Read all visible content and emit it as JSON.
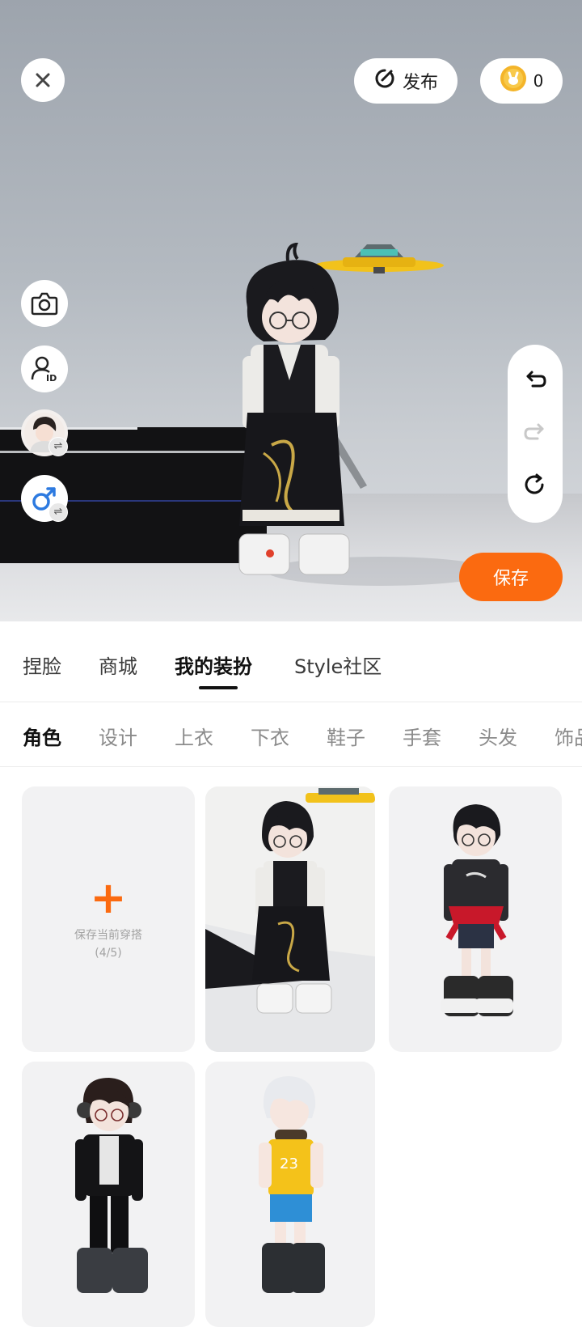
{
  "header": {
    "publish_label": "发布",
    "coin_count": "0"
  },
  "scene": {
    "save_label": "保存"
  },
  "main_tabs": [
    {
      "label": "捏脸"
    },
    {
      "label": "商城"
    },
    {
      "label": "我的装扮"
    },
    {
      "label": "Style社区"
    }
  ],
  "sub_tabs": [
    {
      "label": "角色"
    },
    {
      "label": "设计"
    },
    {
      "label": "上衣"
    },
    {
      "label": "下衣"
    },
    {
      "label": "鞋子"
    },
    {
      "label": "手套"
    },
    {
      "label": "头发"
    },
    {
      "label": "饰品"
    }
  ],
  "add_card": {
    "title": "保存当前穿搭",
    "count": "(4/5)"
  },
  "icons": {
    "close": "close-icon",
    "publish": "publish-icon",
    "coin": "coin-icon",
    "camera": "camera-icon",
    "id": "user-id-icon",
    "avatar_swap": "avatar-swap-icon",
    "gender": "male-gender-icon",
    "undo": "undo-icon",
    "redo": "redo-icon",
    "reset": "reset-icon"
  },
  "colors": {
    "accent": "#fb6a10",
    "active_tab": "#111111",
    "inactive_tab": "#8b8b8b"
  }
}
